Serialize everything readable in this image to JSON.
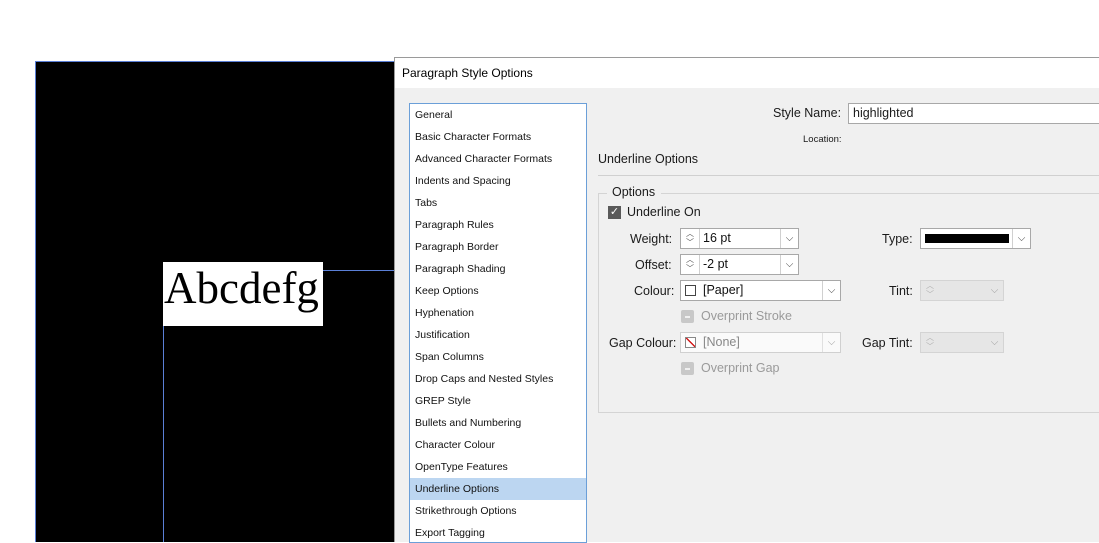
{
  "dialog": {
    "title": "Paragraph Style Options"
  },
  "document": {
    "sample_text": "Abcdefg"
  },
  "categories": [
    {
      "label": "General",
      "selected": false
    },
    {
      "label": "Basic Character Formats",
      "selected": false
    },
    {
      "label": "Advanced Character Formats",
      "selected": false
    },
    {
      "label": "Indents and Spacing",
      "selected": false
    },
    {
      "label": "Tabs",
      "selected": false
    },
    {
      "label": "Paragraph Rules",
      "selected": false
    },
    {
      "label": "Paragraph Border",
      "selected": false
    },
    {
      "label": "Paragraph Shading",
      "selected": false
    },
    {
      "label": "Keep Options",
      "selected": false
    },
    {
      "label": "Hyphenation",
      "selected": false
    },
    {
      "label": "Justification",
      "selected": false
    },
    {
      "label": "Span Columns",
      "selected": false
    },
    {
      "label": "Drop Caps and Nested Styles",
      "selected": false
    },
    {
      "label": "GREP Style",
      "selected": false
    },
    {
      "label": "Bullets and Numbering",
      "selected": false
    },
    {
      "label": "Character Colour",
      "selected": false
    },
    {
      "label": "OpenType Features",
      "selected": false
    },
    {
      "label": "Underline Options",
      "selected": true
    },
    {
      "label": "Strikethrough Options",
      "selected": false
    },
    {
      "label": "Export Tagging",
      "selected": false
    }
  ],
  "header": {
    "style_name_label": "Style Name:",
    "style_name_value": "highlighted",
    "location_label": "Location:"
  },
  "section": {
    "title": "Underline Options",
    "group_label": "Options"
  },
  "options": {
    "underline_on_label": "Underline On",
    "underline_on_checked": true,
    "weight_label": "Weight:",
    "weight_value": "16 pt",
    "offset_label": "Offset:",
    "offset_value": "-2 pt",
    "type_label": "Type:",
    "colour_label": "Colour:",
    "colour_value": "[Paper]",
    "tint_label": "Tint:",
    "overprint_stroke_label": "Overprint Stroke",
    "gap_colour_label": "Gap Colour:",
    "gap_colour_value": "[None]",
    "gap_tint_label": "Gap Tint:",
    "overprint_gap_label": "Overprint Gap"
  },
  "colors": {
    "selection_highlight": "#bcd6f1",
    "list_border": "#6b9fd8",
    "guide_blue": "#5a7fd6"
  },
  "icons": {
    "spin": "spinner-arrows-icon",
    "dropdown": "chevron-down-icon",
    "check": "checkmark-icon",
    "swatch_none": "none-swatch-icon"
  }
}
